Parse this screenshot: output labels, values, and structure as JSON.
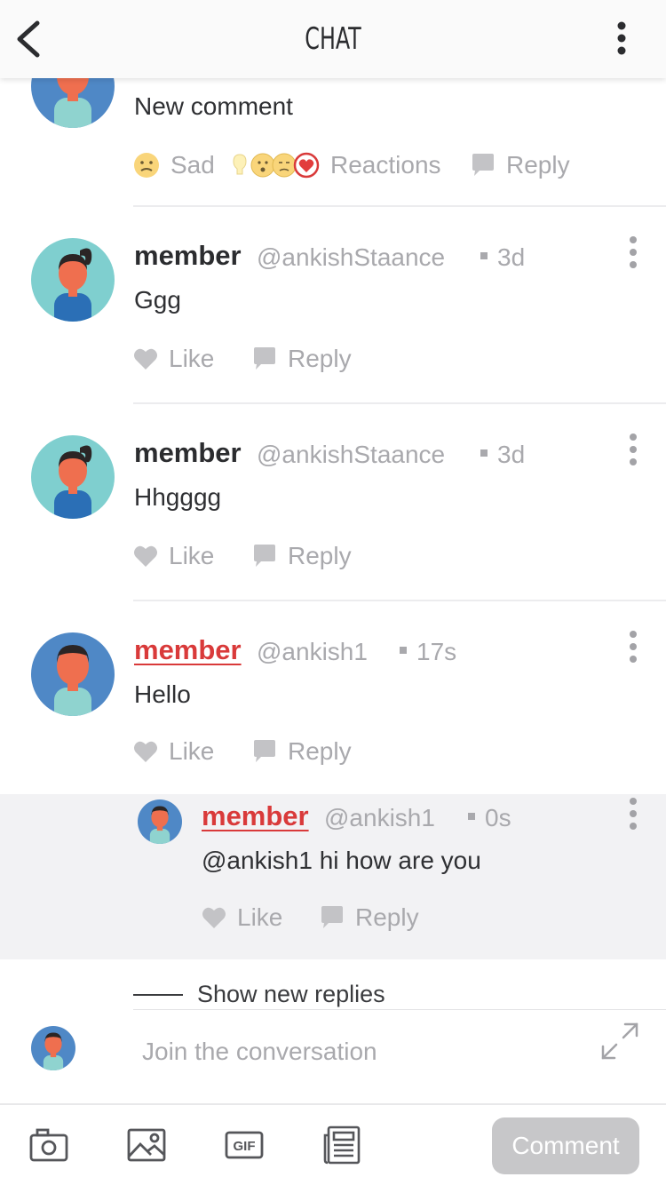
{
  "header": {
    "title": "CHAT"
  },
  "top_comment": {
    "text": "New comment",
    "sad_label": "Sad",
    "reactions_label": "Reactions",
    "reply_label": "Reply"
  },
  "comments": [
    {
      "name": "member",
      "handle": "@ankishStaance",
      "time": "3d",
      "text": "Ggg",
      "like": "Like",
      "reply": "Reply"
    },
    {
      "name": "member",
      "handle": "@ankishStaance",
      "time": "3d",
      "text": "Hhgggg",
      "like": "Like",
      "reply": "Reply"
    },
    {
      "name": "member",
      "handle": "@ankish1",
      "time": "17s",
      "text": "Hello",
      "like": "Like",
      "reply": "Reply"
    }
  ],
  "nested_reply": {
    "name": "member",
    "handle": "@ankish1",
    "time": "0s",
    "text": "@ankish1 hi how are you",
    "like": "Like",
    "reply": "Reply"
  },
  "show_new_replies": "Show new replies",
  "composer": {
    "placeholder": "Join the conversation",
    "comment_button": "Comment"
  },
  "toolbar": {
    "gif_label": "GIF"
  },
  "colors": {
    "accent_red": "#d93a3a",
    "muted": "#a9a9ad",
    "avatar_teal": "#7fcfcf",
    "avatar_blue": "#4f88c6"
  }
}
